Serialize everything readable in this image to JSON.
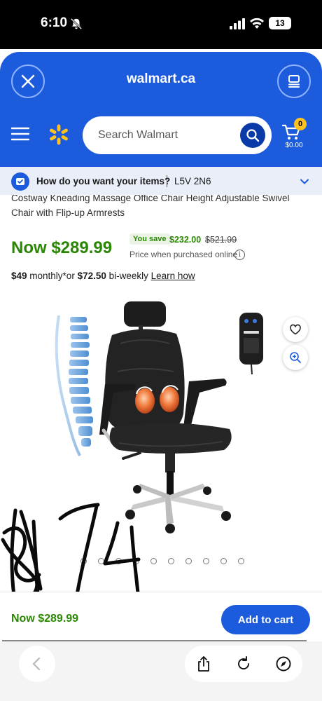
{
  "status_bar": {
    "time": "6:10",
    "battery": "13"
  },
  "header": {
    "domain": "walmart.ca",
    "close_icon": "close-icon",
    "tabs_icon": "tabs-icon"
  },
  "nav": {
    "search_placeholder": "Search Walmart",
    "cart_count": "0",
    "cart_amount": "$0.00"
  },
  "delivery": {
    "question": "How do you want your items?",
    "postal_code": "L5V 2N6"
  },
  "product": {
    "title": "Costway Kneading Massage Office Chair Height Adjustable Swivel Chair with Flip-up Armrests",
    "price_now": "Now $289.99",
    "you_save_label": "You save",
    "save_amount": "$232.00",
    "was_price": "$521.99",
    "price_note": "Price when purchased online",
    "installment_monthly": "$49",
    "installment_monthly_suffix": " monthly*or ",
    "installment_biweekly": "$72.50",
    "installment_biweekly_suffix": " bi-weekly ",
    "learn_how": "Learn how",
    "image_count": 10,
    "current_image": 4,
    "handwritten_note": "$174"
  },
  "sticky_bar": {
    "price": "Now $289.99",
    "add_to_cart": "Add to cart"
  },
  "colors": {
    "walmart_blue": "#1c5bdc",
    "dark_blue": "#0a3aa8",
    "spark_yellow": "#ffc220",
    "price_green": "#2a8703"
  }
}
